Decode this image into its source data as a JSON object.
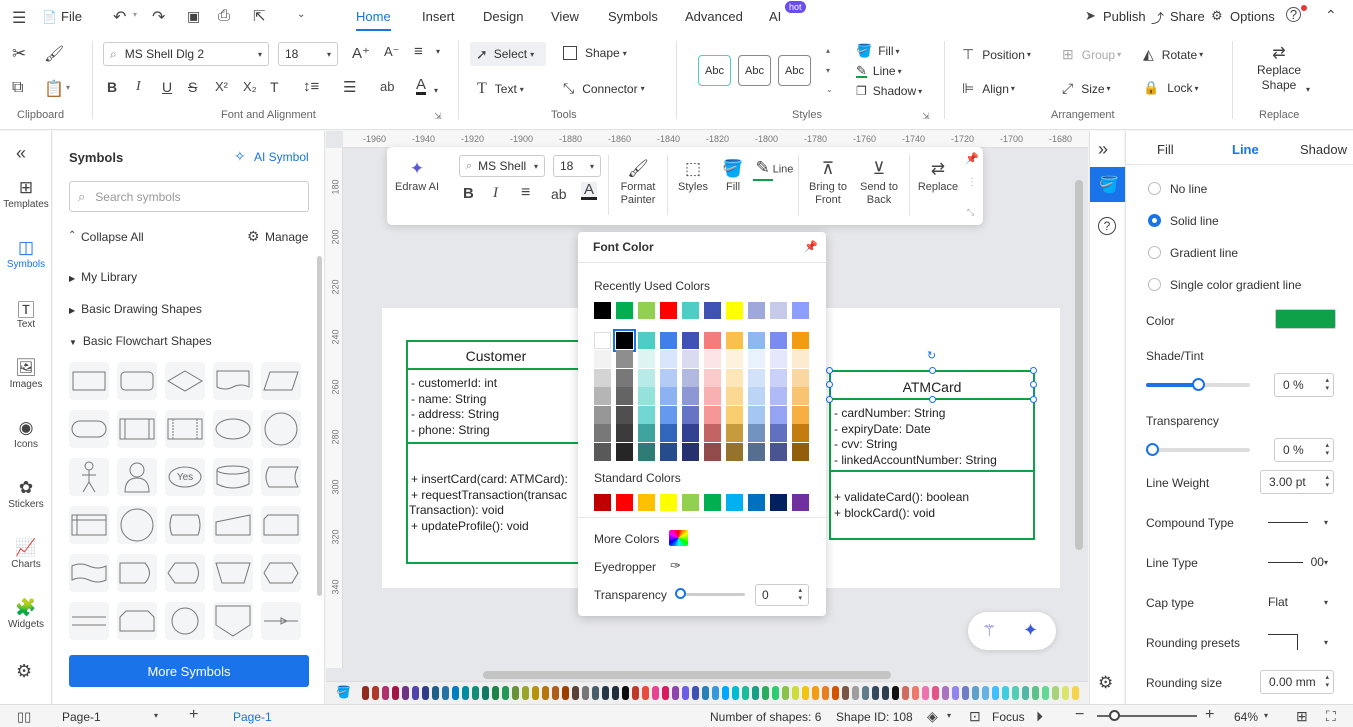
{
  "menubar": {
    "file": "File",
    "tabs": [
      "Home",
      "Insert",
      "Design",
      "View",
      "Symbols",
      "Advanced",
      "AI"
    ],
    "hot": "hot",
    "publish": "Publish",
    "share": "Share",
    "options": "Options"
  },
  "ribbon": {
    "clipboard": "Clipboard",
    "font_and_alignment": "Font and Alignment",
    "tools": "Tools",
    "styles": "Styles",
    "arrangement": "Arrangement",
    "replace_group": "Replace",
    "font_name": "MS Shell Dlg 2",
    "font_size": "18",
    "select": "Select",
    "shape": "Shape",
    "text": "Text",
    "connector": "Connector",
    "style_samples": [
      "Abc",
      "Abc",
      "Abc"
    ],
    "fill": "Fill",
    "line": "Line",
    "shadow": "Shadow",
    "position": "Position",
    "group": "Group",
    "rotate": "Rotate",
    "align": "Align",
    "size": "Size",
    "lock": "Lock",
    "replace_shape": "Replace Shape"
  },
  "rail": [
    "Templates",
    "Symbols",
    "Text",
    "Images",
    "Icons",
    "Stickers",
    "Charts",
    "Widgets"
  ],
  "symbols": {
    "title": "Symbols",
    "ai_symbol": "AI Symbol",
    "search_placeholder": "Search symbols",
    "collapse_all": "Collapse All",
    "manage": "Manage",
    "my_library": "My Library",
    "basic_drawing": "Basic Drawing Shapes",
    "basic_flowchart": "Basic Flowchart Shapes",
    "yes": "Yes",
    "more": "More Symbols"
  },
  "ruler_top": [
    "-1960",
    "-1940",
    "-1920",
    "-1900",
    "-1880",
    "-1860",
    "-1840",
    "-1820",
    "-1800",
    "-1780",
    "-1760",
    "-1740",
    "-1720",
    "-1700",
    "-1680"
  ],
  "ruler_left": [
    "180",
    "200",
    "220",
    "240",
    "260",
    "280",
    "300",
    "320",
    "340"
  ],
  "float": {
    "edraw_ai": "Edraw AI",
    "font": "MS Shell",
    "size": "18",
    "format_painter": "Format Painter",
    "styles": "Styles",
    "fill": "Fill",
    "line": "Line",
    "bring_front": "Bring to Front",
    "send_back": "Send to Back",
    "replace": "Replace"
  },
  "customer": {
    "title": "Customer",
    "attrs": [
      "- customerId: int",
      "- name: String",
      "- address: String",
      "- phone: String"
    ],
    "methods": [
      "+ insertCard(card: ATMCard):",
      "+ requestTransaction(transac",
      "Transaction): void",
      "+ updateProfile(): void"
    ]
  },
  "atmcard": {
    "title": "ATMCard",
    "attrs": [
      "- cardNumber: String",
      "- expiryDate: Date",
      "- cvv: String",
      "- linkedAccountNumber: String"
    ],
    "methods": [
      "+ validateCard(): boolean",
      "+ blockCard(): void"
    ]
  },
  "font_color": {
    "title": "Font Color",
    "recent": "Recently Used Colors",
    "standard": "Standard Colors",
    "more": "More Colors",
    "eyedropper": "Eyedropper",
    "transparency": "Transparency",
    "transparency_value": "0",
    "recent_colors": [
      "#000000",
      "#00b050",
      "#92d050",
      "#ff0000",
      "#4ecdc4",
      "#3f51b5",
      "#ffff00",
      "#9fa8da",
      "#c5cae9",
      "#8c9eff"
    ],
    "grid_top": [
      "#ffffff",
      "#000000",
      "#4ecdc4",
      "#3f7fe8",
      "#3f51b5",
      "#f47c7c",
      "#f9c04e",
      "#8fb8f0",
      "#7b8cf0",
      "#f39c12"
    ],
    "standard_colors": [
      "#c00000",
      "#ff0000",
      "#ffc000",
      "#ffff00",
      "#92d050",
      "#00b050",
      "#00b0f0",
      "#0070c0",
      "#002060",
      "#7030a0"
    ]
  },
  "rpanel": {
    "fill": "Fill",
    "line": "Line",
    "shadow": "Shadow",
    "no_line": "No line",
    "solid_line": "Solid line",
    "gradient_line": "Gradient line",
    "single_gradient": "Single color gradient line",
    "color": "Color",
    "color_value": "#0fa14a",
    "shade": "Shade/Tint",
    "shade_value": "0 %",
    "transparency": "Transparency",
    "transparency_value": "0 %",
    "weight": "Line Weight",
    "weight_value": "3.00 pt",
    "compound": "Compound Type",
    "line_type": "Line Type",
    "line_type_value": "00",
    "cap": "Cap type",
    "cap_value": "Flat",
    "rounding_presets": "Rounding presets",
    "rounding_size": "Rounding size",
    "rounding_value": "0.00 mm"
  },
  "status": {
    "page_select": "Page-1",
    "page_tab": "Page-1",
    "shapes": "Number of shapes: 6",
    "shape_id": "Shape ID: 108",
    "focus": "Focus",
    "zoom": "64%"
  }
}
